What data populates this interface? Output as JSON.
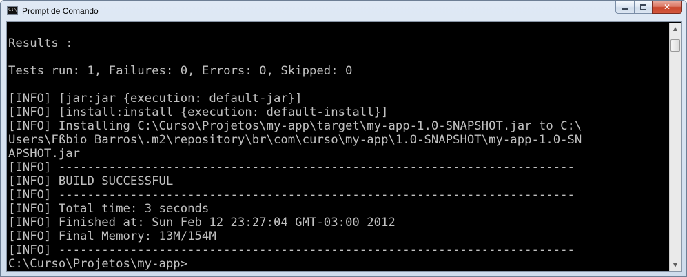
{
  "window": {
    "title": "Prompt de Comando",
    "icon_label": "C:\\",
    "buttons": {
      "minimize": "",
      "maximize": "",
      "close": "✕"
    }
  },
  "console": {
    "lines": [
      "",
      "Results :",
      "",
      "Tests run: 1, Failures: 0, Errors: 0, Skipped: 0",
      "",
      "[INFO] [jar:jar {execution: default-jar}]",
      "[INFO] [install:install {execution: default-install}]",
      "[INFO] Installing C:\\Curso\\Projetos\\my-app\\target\\my-app-1.0-SNAPSHOT.jar to C:\\",
      "Users\\Fßbio Barros\\.m2\\repository\\br\\com\\curso\\my-app\\1.0-SNAPSHOT\\my-app-1.0-SN",
      "APSHOT.jar",
      "[INFO] ------------------------------------------------------------------------",
      "[INFO] BUILD SUCCESSFUL",
      "[INFO] ------------------------------------------------------------------------",
      "[INFO] Total time: 3 seconds",
      "[INFO] Finished at: Sun Feb 12 23:27:04 GMT-03:00 2012",
      "[INFO] Final Memory: 13M/154M",
      "[INFO] ------------------------------------------------------------------------",
      "C:\\Curso\\Projetos\\my-app>"
    ]
  },
  "scrollbar": {
    "up_arrow": "▲",
    "down_arrow": "▼"
  }
}
